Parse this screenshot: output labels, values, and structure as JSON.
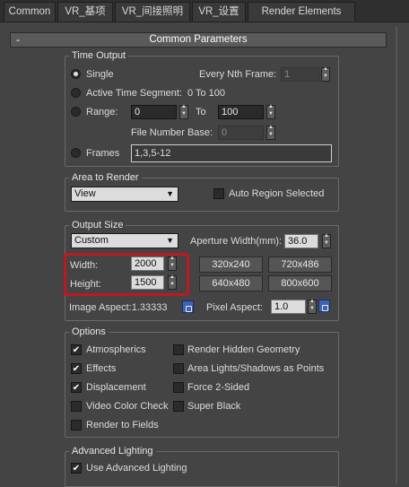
{
  "tabs": [
    "Common",
    "VR_基项",
    "VR_间接照明",
    "VR_设置",
    "Render Elements"
  ],
  "rollout": {
    "sign": "-",
    "title": "Common Parameters"
  },
  "time_output": {
    "group_label": "Time Output",
    "single": "Single",
    "every_nth_label": "Every Nth Frame:",
    "every_nth_value": "1",
    "active_segment": "Active Time Segment:",
    "active_segment_range": "0 To 100",
    "range": "Range:",
    "range_from": "0",
    "range_to_label": "To",
    "range_to": "100",
    "file_number_base_label": "File Number Base:",
    "file_number_base": "0",
    "frames": "Frames",
    "frames_value": "1,3,5-12"
  },
  "area_to_render": {
    "group_label": "Area to Render",
    "selected": "View",
    "auto_region": "Auto Region Selected"
  },
  "output_size": {
    "group_label": "Output Size",
    "preset": "Custom",
    "aperture_label": "Aperture Width(mm):",
    "aperture_value": "36.0",
    "width_label": "Width:",
    "width_value": "2000",
    "height_label": "Height:",
    "height_value": "1500",
    "presets": [
      "320x240",
      "720x486",
      "640x480",
      "800x600"
    ],
    "image_aspect": "Image Aspect:1.33333",
    "pixel_aspect_label": "Pixel Aspect:",
    "pixel_aspect_value": "1.0"
  },
  "options": {
    "group_label": "Options",
    "items_left": [
      {
        "label": "Atmospherics",
        "checked": true
      },
      {
        "label": "Effects",
        "checked": true
      },
      {
        "label": "Displacement",
        "checked": true
      },
      {
        "label": "Video Color Check",
        "checked": false
      },
      {
        "label": "Render to Fields",
        "checked": false
      }
    ],
    "items_right": [
      {
        "label": "Render Hidden Geometry",
        "checked": false
      },
      {
        "label": "Area Lights/Shadows as Points",
        "checked": false
      },
      {
        "label": "Force 2-Sided",
        "checked": false
      },
      {
        "label": "Super Black",
        "checked": false
      }
    ]
  },
  "advanced_lighting": {
    "group_label": "Advanced Lighting",
    "use_advanced": "Use Advanced Lighting"
  }
}
